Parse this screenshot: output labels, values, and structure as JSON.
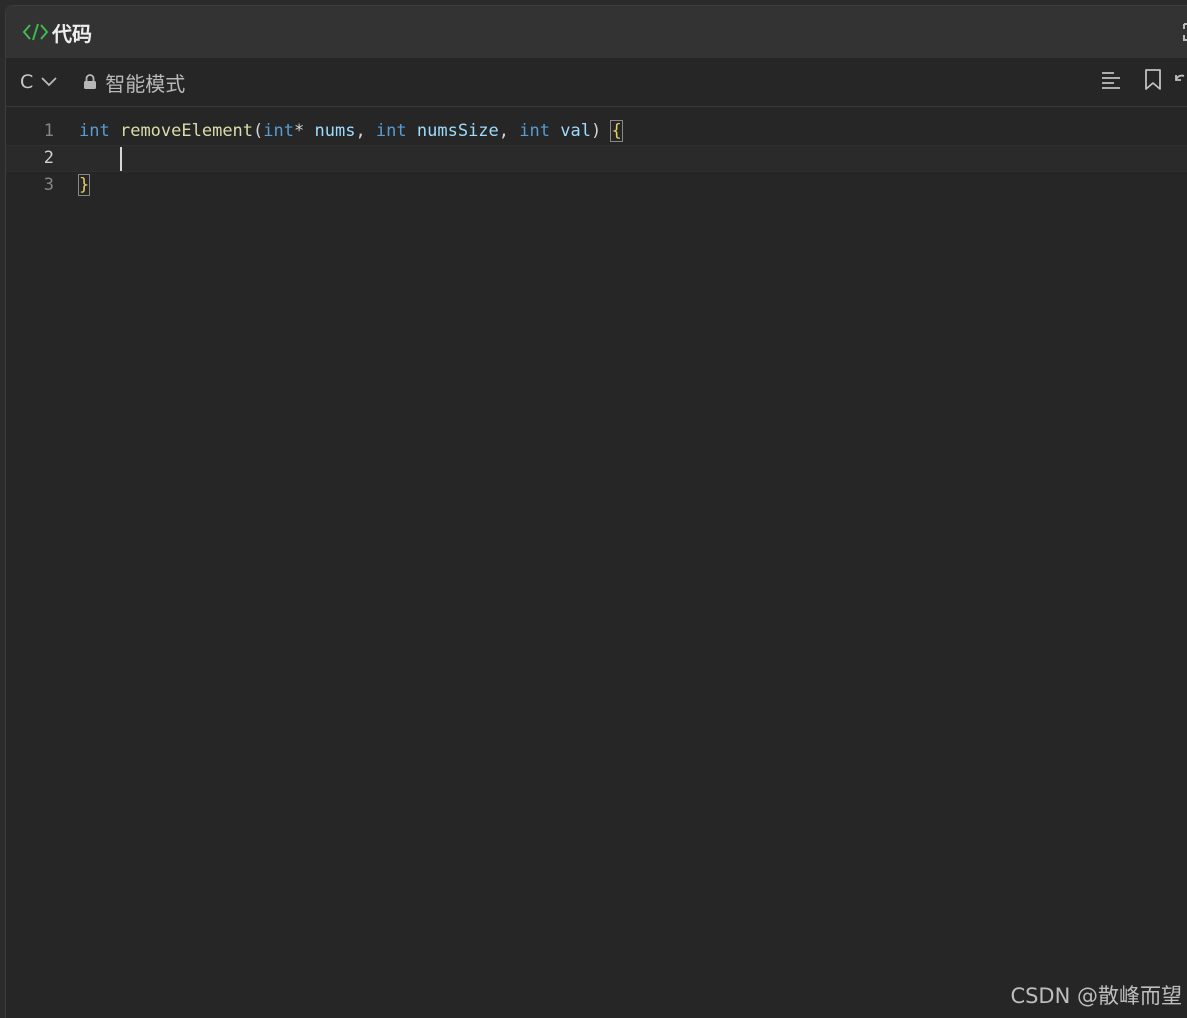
{
  "window": {
    "title": "代码",
    "accent_color": "#3fb950"
  },
  "toolbar": {
    "language": "C",
    "mode_label": "智能模式"
  },
  "editor": {
    "lines": [
      {
        "number": "1",
        "tokens": {
          "kw1": "int",
          "fn": "removeElement",
          "p1": "(",
          "kw2": "int",
          "star": "* ",
          "a1": "nums",
          "c1": ", ",
          "kw3": "int",
          "a2": "numsSize",
          "c2": ", ",
          "kw4": "int",
          "a3": "val",
          "p2": ") ",
          "brace": "{"
        }
      },
      {
        "number": "2",
        "text": ""
      },
      {
        "number": "3",
        "text": "}"
      }
    ],
    "active_line": 2
  },
  "watermark": "CSDN @散峰而望"
}
